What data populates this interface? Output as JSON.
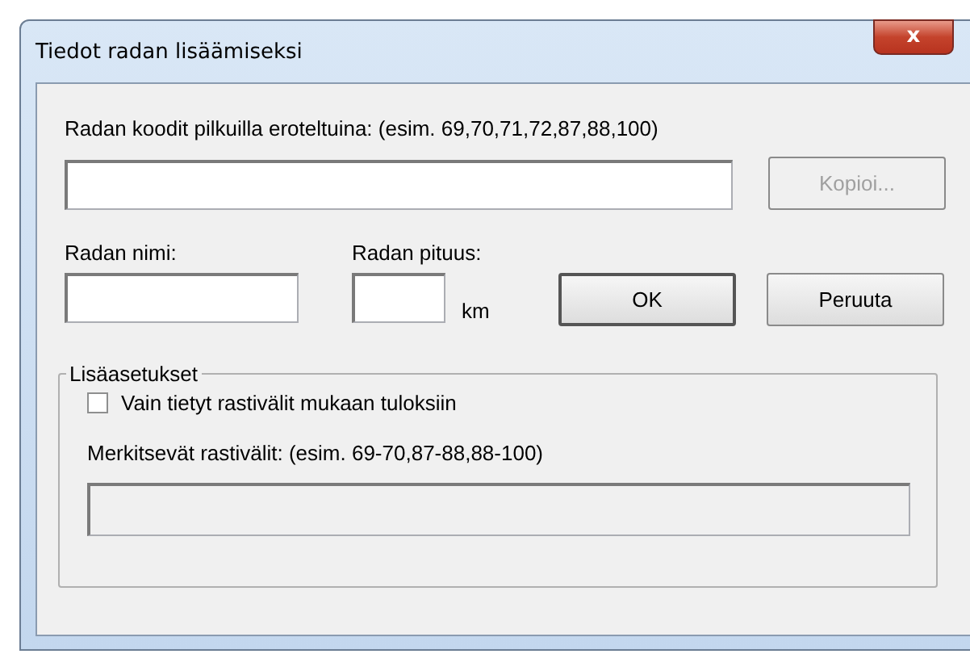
{
  "window": {
    "title": "Tiedot radan lisäämiseksi",
    "close": "x"
  },
  "codes": {
    "label": "Radan koodit pilkuilla eroteltuina: (esim. 69,70,71,72,87,88,100)",
    "copy_button": {
      "label": "Kopioi...",
      "disabled": true
    }
  },
  "name": {
    "label": "Radan nimi:"
  },
  "length": {
    "label": "Radan pituus:",
    "unit": "km"
  },
  "buttons": [
    {
      "label": "OK",
      "default": true
    },
    {
      "label": "Peruuta",
      "default": false
    }
  ],
  "advanced": {
    "title": "Lisäasetukset",
    "checkbox": {
      "label": "Vain tietyt rastivälit mukaan tuloksiin",
      "checked": false
    },
    "legs_label": "Merkitsevät rastivälit: (esim. 69-70,87-88,88-100)",
    "legs_field": {
      "disabled": true
    }
  }
}
